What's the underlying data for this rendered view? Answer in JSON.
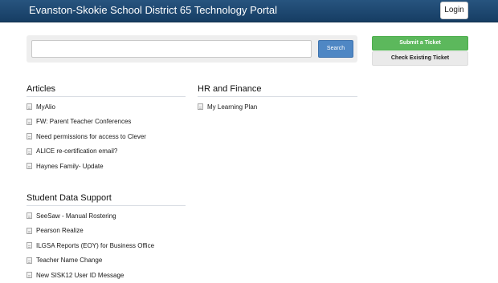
{
  "header": {
    "title": "Evanston-Skokie School District 65 Technology Portal",
    "login_label": "Login"
  },
  "search": {
    "value": "",
    "placeholder": "",
    "button_label": "Search"
  },
  "actions": {
    "submit_label": "Submit a Ticket",
    "check_label": "Check Existing Ticket"
  },
  "sections": {
    "articles": {
      "title": "Articles",
      "items": [
        "MyAlio",
        "FW: Parent Teacher Conferences",
        "Need permissions for access to Clever",
        "ALICE re-certification email?",
        "Haynes Family- Update"
      ]
    },
    "hr": {
      "title": "HR and Finance",
      "items": [
        "My Learning Plan"
      ]
    },
    "student": {
      "title": "Student Data Support",
      "items": [
        "SeeSaw - Manual Rostering",
        "Pearson Realize",
        "ILGSA Reports (EOY) for Business Office",
        "Teacher Name Change",
        "New SISK12 User ID Message"
      ]
    }
  },
  "icons": {
    "item_icon": "document-icon"
  },
  "colors": {
    "header": "#1d4670",
    "search_button": "#4f87c4",
    "submit_button": "#5cb85c"
  }
}
